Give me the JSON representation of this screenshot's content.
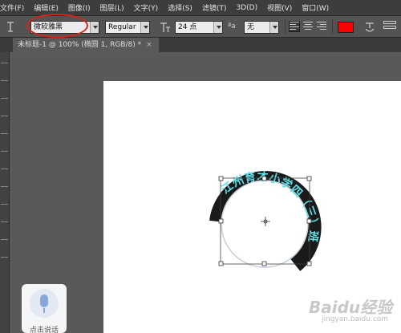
{
  "menu": [
    "文件(F)",
    "编辑(E)",
    "图像(I)",
    "图层(L)",
    "文字(Y)",
    "选择(S)",
    "滤镜(T)",
    "3D(D)",
    "视图(V)",
    "窗口(W)"
  ],
  "options": {
    "font_family": "微软雅黑",
    "font_style": "Regular",
    "font_size": "24 点",
    "aa_label": "ªa",
    "aa_mode": "无",
    "text_color": "#ff0000",
    "highlight_color": "#d6231c"
  },
  "document": {
    "tab_label": "未标题-1 @ 100% (椭圆 1, RGB/8) *",
    "close_glyph": "×"
  },
  "canvas": {
    "path_text": "江州育才小学四（三）班",
    "text_color": "#63e0e8",
    "ring_color": "#1a1a1a"
  },
  "voice_widget": {
    "label": "点击说话"
  },
  "watermark": {
    "brand": "Baidu经验",
    "url": "jingyan.baidu.com"
  }
}
